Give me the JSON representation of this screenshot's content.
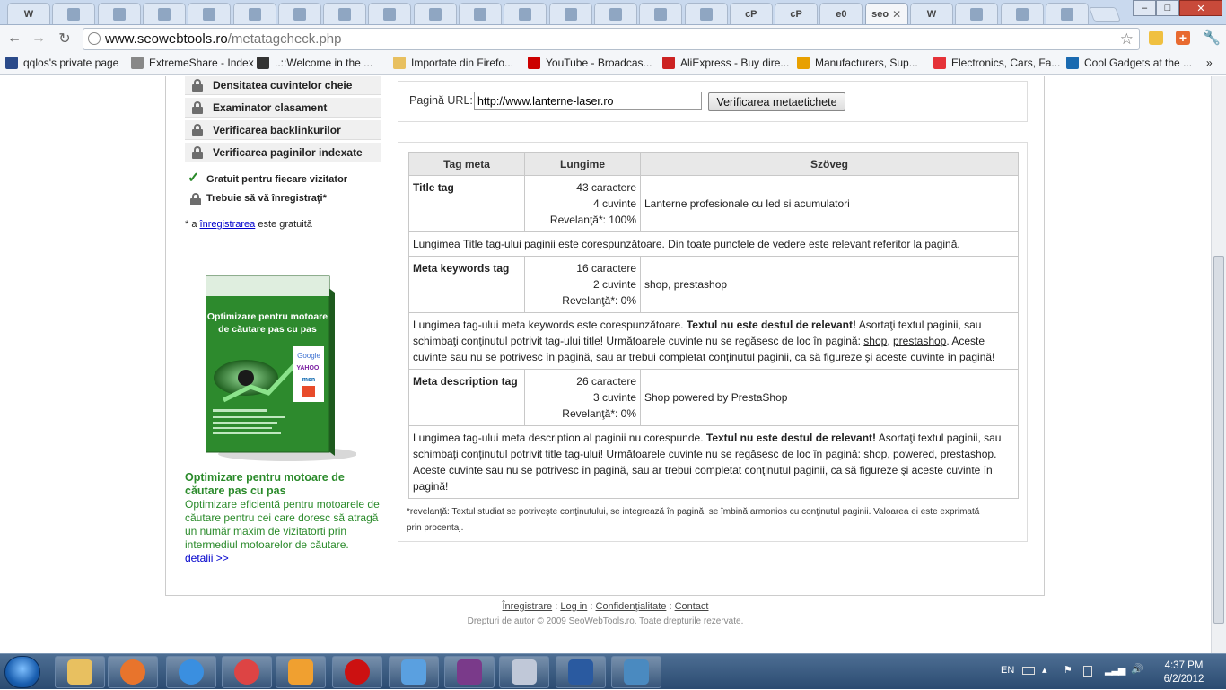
{
  "browser": {
    "url_domain": "www.seowebtools.ro",
    "url_path": "/metatagcheck.php",
    "active_tab_label": "seo",
    "tab_labels": [
      "W",
      "",
      "",
      "",
      "",
      "",
      "",
      "",
      "",
      "",
      "",
      "",
      "",
      "",
      "",
      "",
      "cP",
      "cP",
      "e0",
      "seo",
      "W",
      "",
      "",
      ""
    ],
    "window_controls": {
      "minimize": "–",
      "maximize": "□",
      "close": "✕"
    }
  },
  "bookmarks": [
    {
      "label": "qqlos's private page",
      "icon": "fl-icon",
      "color": "#2a4a8a"
    },
    {
      "label": "ExtremeShare - Index",
      "icon": "globe-icon",
      "color": "#888888"
    },
    {
      "label": "..::Welcome in the ...",
      "icon": "hand-icon",
      "color": "#333333"
    },
    {
      "label": "Importate din Firefo...",
      "icon": "folder-icon",
      "color": "#e8c060"
    },
    {
      "label": "YouTube - Broadcas...",
      "icon": "youtube-icon",
      "color": "#cc0000"
    },
    {
      "label": "AliExpress - Buy dire...",
      "icon": "cart-icon",
      "color": "#cc2222"
    },
    {
      "label": "Manufacturers, Sup...",
      "icon": "star-icon",
      "color": "#e8a000"
    },
    {
      "label": "Electronics, Cars, Fa...",
      "icon": "ebay-icon",
      "color": "#e53238"
    },
    {
      "label": "Cool Gadgets at the ...",
      "icon": "dx-icon",
      "color": "#1a6ab0"
    }
  ],
  "sidebar": {
    "items": [
      {
        "label": "Densitatea cuvintelor cheie"
      },
      {
        "label": "Examinator clasament"
      },
      {
        "label": "Verificarea backlinkurilor"
      },
      {
        "label": "Verificarea paginilor indexate"
      }
    ],
    "free_label": "Gratuit pentru fiecare vizitator",
    "register_label": "Trebuie să vă înregistraţi*",
    "note_prefix": "* a",
    "note_link": "înregistrarea",
    "note_suffix": "este gratuită"
  },
  "book": {
    "title": "Optimizare pentru motoare de căutare pas cu pas",
    "brands": [
      "Google",
      "YAHOO!",
      "msn",
      ""
    ]
  },
  "promo": {
    "title": "Optimizare pentru motoare de căutare pas cu pas",
    "text": "Optimizare eficientă pentru motoarele de căutare pentru cei care doresc să atragă un număr maxim de vizitatorti prin intermediul motoarelor de căutare.",
    "link": "detalii >>"
  },
  "form": {
    "label": "Pagină URL:",
    "value": "http://www.lanterne-laser.ro",
    "button": "Verificarea metaetichete"
  },
  "table": {
    "headers": [
      "Tag meta",
      "Lungime",
      "Szöveg"
    ],
    "rows": [
      {
        "name": "Title tag",
        "chars": "43 caractere",
        "words": "4 cuvinte",
        "relevance": "Revelanţă*: 100%",
        "text": "Lanterne profesionale cu led si acumulatori",
        "msg_a": "Lungimea Title tag-ului paginii este corespunzătoare. Din toate punctele de vedere este relevant referitor la pagină.",
        "msg_b": "",
        "msg_c": "",
        "links": [],
        "msg_d": ""
      },
      {
        "name": "Meta keywords tag",
        "chars": "16 caractere",
        "words": "2 cuvinte",
        "relevance": "Revelanţă*: 0%",
        "text": "shop, prestashop",
        "msg_a": "Lungimea tag-ului meta keywords este corespunzătoare.",
        "msg_b": "Textul nu este destul de relevant!",
        "msg_c": "Asortaţi textul paginii, sau schimbaţi conţinutul potrivit tag-ului title! Următoarele cuvinte nu se regăsesc de loc în pagină:",
        "links": [
          "shop",
          "prestashop"
        ],
        "msg_d": ". Aceste cuvinte sau nu se potrivesc în pagină, sau ar trebui completat conţinutul paginii, ca să figureze şi aceste cuvinte în pagină!"
      },
      {
        "name": "Meta description tag",
        "chars": "26 caractere",
        "words": "3 cuvinte",
        "relevance": "Revelanţă*: 0%",
        "text": "Shop powered by PrestaShop",
        "msg_a": "Lungimea tag-ului meta description al paginii nu corespunde.",
        "msg_b": "Textul nu este destul de relevant!",
        "msg_c": "Asortaţi textul paginii, sau schimbaţi conţinutul potrivit title tag-ului! Următoarele cuvinte nu se regăsesc de loc în pagină:",
        "links": [
          "shop",
          "powered",
          "prestashop"
        ],
        "msg_d": ". Aceste cuvinte sau nu se potrivesc în pagină, sau ar trebui completat conţinutul paginii, ca să figureze şi aceste cuvinte în pagină!"
      }
    ],
    "footnote": "*revelanţă: Textul studiat se potriveşte conţinutului, se integrează în pagină, se îmbină armonios cu conţinutul paginii. Valoarea ei este exprimată prin procentaj."
  },
  "footer": {
    "links": [
      "Înregistrare",
      "Log in",
      "Confidenţialitate",
      "Contact"
    ],
    "separator": ":",
    "copyright": "Drepturi de autor © 2009 SeoWebTools.ro. Toate drepturile rezervate."
  },
  "taskbar": {
    "apps": [
      {
        "name": "explorer",
        "color": "#e8c060"
      },
      {
        "name": "firefox",
        "color": "#e8742c"
      },
      {
        "name": "internet-explorer",
        "color": "#3a8fe0"
      },
      {
        "name": "chrome",
        "color": "#d44"
      },
      {
        "name": "media-player",
        "color": "#f0a030"
      },
      {
        "name": "opera",
        "color": "#cc1111"
      },
      {
        "name": "messenger",
        "color": "#5aa0e0"
      },
      {
        "name": "winrar",
        "color": "#7a3a8a"
      },
      {
        "name": "paint",
        "color": "#c0c8d8"
      },
      {
        "name": "feather-app",
        "color": "#2a5aa0"
      },
      {
        "name": "photo-viewer",
        "color": "#4a8ac0"
      }
    ],
    "language": "EN",
    "time": "4:37 PM",
    "date": "6/2/2012"
  },
  "colors": {
    "accent_green": "#2a8a2a",
    "link_blue": "#0000cc",
    "taskbar": "#2b4b71"
  }
}
